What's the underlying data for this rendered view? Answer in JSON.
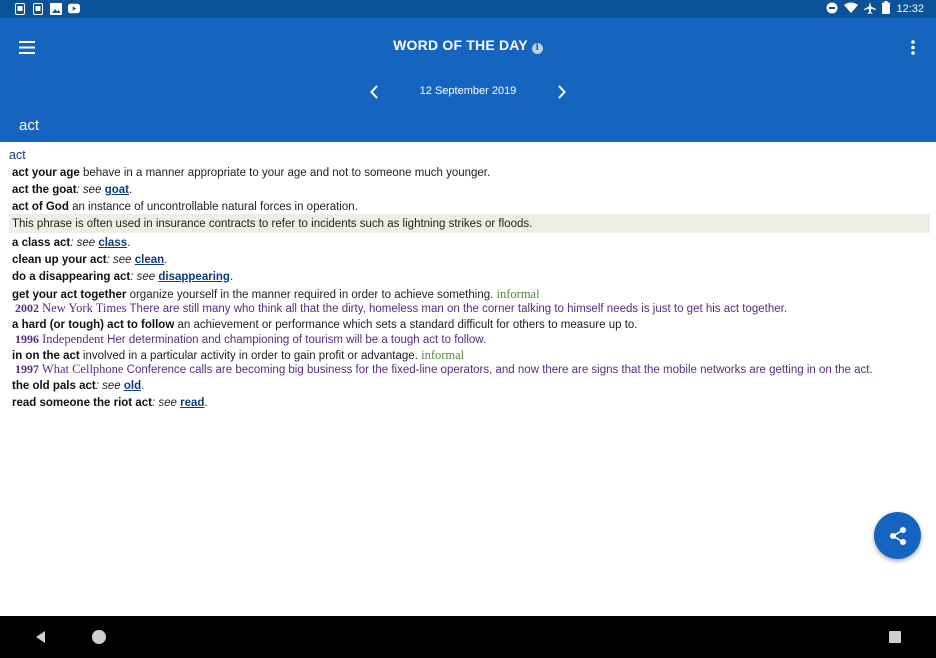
{
  "status_bar": {
    "left_icons": [
      "sim-icon",
      "sim-icon",
      "image-icon",
      "youtube-icon"
    ],
    "right_icons": [
      "do-not-disturb-icon",
      "wifi-icon",
      "airplane-icon",
      "battery-icon"
    ],
    "time": "12:32"
  },
  "app_bar": {
    "title": "WORD OF THE DAY",
    "info_glyph": "i",
    "date": "12 September 2019",
    "word": "act",
    "color": "#1565c0"
  },
  "entry": {
    "headword": "act",
    "lines": [
      {
        "phrase": "act your age",
        "text": " behave in a manner appropriate to your age and not to someone much younger."
      },
      {
        "phrase": "act the goat",
        "see": ": see ",
        "xref": "goat",
        "end": "."
      },
      {
        "phrase": "act of God",
        "text": " an instance of uncontrollable natural forces in operation."
      },
      {
        "note": "This phrase is often used in insurance contracts to refer to incidents such as lightning strikes or floods."
      },
      {
        "phrase": "a class act",
        "see": ": see ",
        "xref": "class",
        "end": "."
      },
      {
        "phrase": "clean up your act",
        "see": ": see ",
        "xref": "clean",
        "end": "."
      },
      {
        "phrase": "do a disappearing act",
        "see": ": see ",
        "xref": "disappearing",
        "end": "."
      },
      {
        "phrase": "get your act together",
        "text": " organize yourself in the manner required in order to achieve something. ",
        "register": "informal"
      },
      {
        "quote_year": "2002",
        "quote_source": " New York Times",
        "quote_text": " There are still many who think all that the dirty, homeless man on the corner talking to himself needs is just to get his act together."
      },
      {
        "phrase": "a hard (or tough) act to follow",
        "text": " an achievement or performance which sets a standard difficult for others to measure up to."
      },
      {
        "quote_year": "1996",
        "quote_source": " Independent",
        "quote_text": " Her determination and championing of tourism will be a tough act to follow."
      },
      {
        "phrase": "in on the act",
        "text": " involved in a particular activity in order to gain profit or advantage. ",
        "register": "informal"
      },
      {
        "quote_year": "1997",
        "quote_source": " What Cellphone",
        "quote_text": " Conference calls are becoming big business for the fixed-line operators, and now there are signs that the mobile networks are getting in on the act."
      },
      {
        "phrase": "the old pals act",
        "see": ": see ",
        "xref": "old",
        "end": "."
      },
      {
        "phrase": "read someone the riot act",
        "see": ": see ",
        "xref": "read",
        "end": "."
      }
    ]
  },
  "fab": {
    "icon": "share-icon"
  },
  "nav_bar": {
    "icons": [
      "back-icon",
      "home-icon",
      "recents-icon"
    ]
  }
}
